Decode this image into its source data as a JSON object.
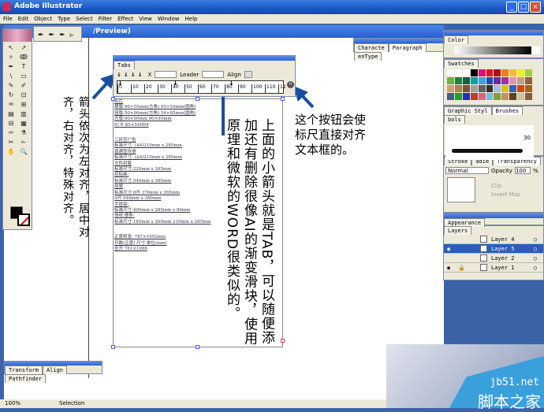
{
  "app": {
    "title": "Adobe Illustrator",
    "doc_title": "/Preview)"
  },
  "menu": [
    "File",
    "Edit",
    "Object",
    "Type",
    "Select",
    "Filter",
    "Effect",
    "View",
    "Window",
    "Help"
  ],
  "window_controls": [
    "_",
    "□",
    "×"
  ],
  "pen_flyout": "✒✒✒▹",
  "toolbox": [
    "↖",
    "↗",
    "✧",
    "ↂ",
    "✒",
    "T",
    "\\",
    "▭",
    "✎",
    "✐",
    "↻",
    "⊡",
    "♒",
    "⊞",
    "▤",
    "▥",
    "⊟",
    "▦",
    "✑",
    "⚗",
    "✂",
    "✁",
    "✋",
    "🔍"
  ],
  "tabs_panel": {
    "tab": "Tabs",
    "x_label": "X",
    "leader_label": "Leader",
    "align_label": "Align",
    "ruler_ticks": [
      "0",
      "10",
      "20",
      "30",
      "40",
      "50",
      "60",
      "70",
      "80",
      "90",
      "100",
      "110",
      "12"
    ],
    "tab_icons": "↓↓↓↓"
  },
  "document_text": [
    "名片",
    "横版:90×55mm(方角) 85×54mm(圆角)",
    "竖版:50×90mm(方角) 54×85mm(圆角)",
    "方版:90×90mm 90×95mm",
    "IC卡  85×54MM",
    "",
    "三折页广告",
    "标准尺寸: (A4)210mm x 285mm",
    "普通宣传册",
    "标准尺寸: (A4)210mm x 285mm",
    "文件封套",
    "标准尺寸:220mm x 305mm",
    "招贴画:",
    "标准尺寸:540mm x 380mm",
    "挂旗",
    "标准尺寸:8开 376mm x 265mm",
    "4开 540mm x 380mm",
    "手提袋:",
    "标准尺寸:400mm x 285mm x 80mm",
    "信纸 便条:",
    "标准尺寸:185mm x 260mm 210mm x 285mm",
    "",
    "正度纸张: 787×1092mm",
    "开数(正度) 尺寸 单位(mm)",
    "全开 781×1086"
  ],
  "annotations": {
    "left": "箭头依次为左对齐，居中对齐，右对齐，特殊对齐。",
    "middle": "上面的小箭头就是TAB，可以随便添加还有删除很像AI的渐变滑块，使用原理和微软的WORD很类似的。",
    "right": "这个按钮会使标尺直接对齐文本框的。"
  },
  "char_panel": {
    "tabs": [
      "Characte",
      "Paragraph",
      "enType"
    ]
  },
  "right_panels": {
    "color_tab": "Color",
    "swatches_tab": "Swatches",
    "style_tabs": [
      "Graphic Styl",
      "Brushes",
      "bols"
    ],
    "brush_size": "30",
    "trans_tabs": [
      "Stroke",
      "adie",
      "Transparency"
    ],
    "blend_mode": "Normal",
    "opacity_label": "Opacity",
    "opacity_value": "100",
    "opacity_unit": "%",
    "clip_label": "Clip",
    "invert_label": "Invert Mas",
    "appearance_tab": "Appearance",
    "layers_tab": "Layers",
    "layers": [
      {
        "name": "Layer 4",
        "visible": false
      },
      {
        "name": "Layer 5",
        "visible": true,
        "selected": true
      },
      {
        "name": "Layer 2",
        "visible": false
      },
      {
        "name": "Layer 1",
        "visible": true,
        "locked": true
      }
    ]
  },
  "swatch_colors": [
    "#ffffff",
    "#ffffff",
    "#ffffff",
    "#000000",
    "#e0107a",
    "#e01020",
    "#b01010",
    "#f08010",
    "#f0c030",
    "#f0f020",
    "#a0d040",
    "#70b040",
    "#208040",
    "#106040",
    "#10a0a0",
    "#40a0e0",
    "#1050c0",
    "#6030a0",
    "#a030a0",
    "#e090c0",
    "#c0a080",
    "#906040",
    "#d0a070",
    "#b08050",
    "#805030",
    "#a0a0a0",
    "#606060",
    "#303030",
    "#a0c0e0",
    "#e0c000",
    "#3060c0",
    "#e04000",
    "#a06020",
    "#406080",
    "#20a020",
    "#2030c0",
    "#c04020",
    "#e06080",
    "#70c0e0",
    "#80a040",
    "#c09060",
    "#604020",
    "#d0c0a0",
    "#806040"
  ],
  "transform_panel": {
    "tabs": [
      "Transform",
      "Align",
      "Pathfinder"
    ]
  },
  "status": {
    "zoom": "100%",
    "tool": "Selection"
  },
  "watermark": {
    "url": "jb51.net",
    "name": "脚本之家"
  }
}
